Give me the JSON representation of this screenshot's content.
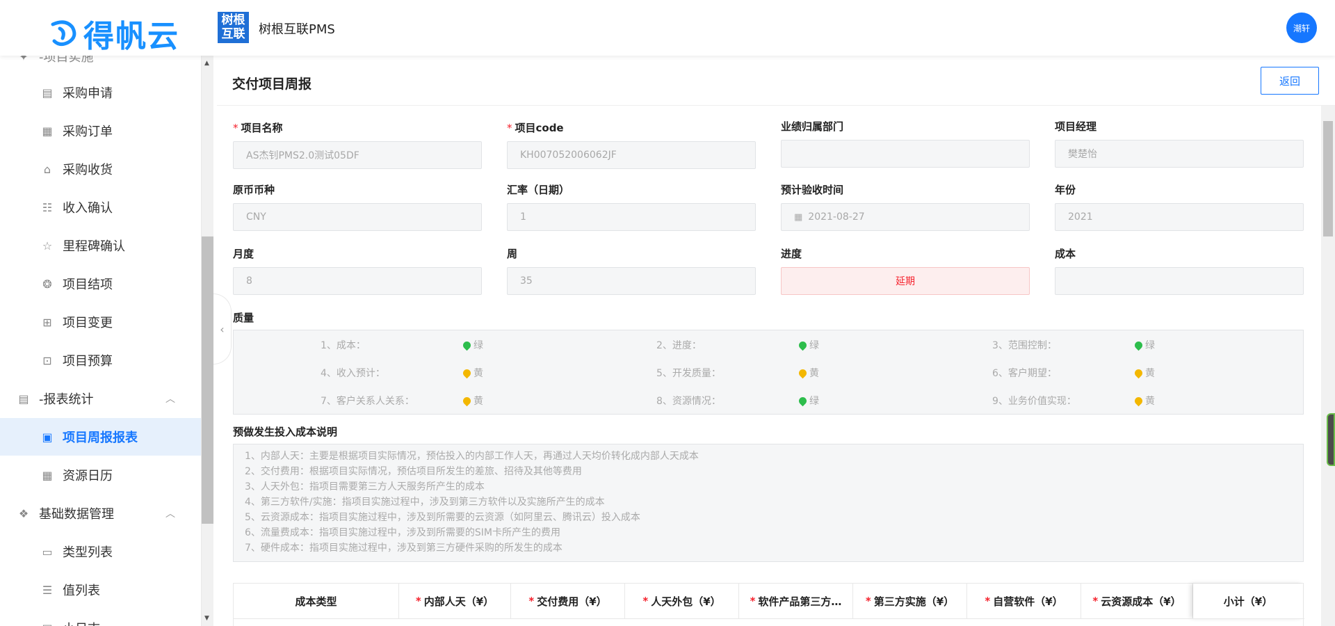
{
  "header": {
    "logo_text": "得帆云",
    "brand_box_text": "树根互联",
    "app_title": "树根互联PMS",
    "avatar_text": "潮轩"
  },
  "sidebar": {
    "partial_top": "-项目实施",
    "items": [
      {
        "label": "采购申请",
        "icon": "form-icon"
      },
      {
        "label": "采购订单",
        "icon": "order-icon"
      },
      {
        "label": "采购收货",
        "icon": "home-icon"
      },
      {
        "label": "收入确认",
        "icon": "list-icon"
      },
      {
        "label": "里程碑确认",
        "icon": "star-icon"
      },
      {
        "label": "项目结项",
        "icon": "award-icon"
      },
      {
        "label": "项目变更",
        "icon": "grid-icon"
      },
      {
        "label": "项目预算",
        "icon": "ticket-icon"
      }
    ],
    "group_report": "-报表统计",
    "active_item": "项目周报报表",
    "item_calendar": "资源日历",
    "group_base": "基础数据管理",
    "item_type_list": "类型列表",
    "item_value_list": "值列表",
    "partial_bottom": "小日志"
  },
  "page": {
    "title": "交付项目周报",
    "back_label": "返回"
  },
  "fields": {
    "project_name": {
      "label": "项目名称",
      "value": "AS杰钊PMS2.0测试05DF"
    },
    "project_code": {
      "label": "项目code",
      "value": "KH007052006062JF"
    },
    "dept": {
      "label": "业绩归属部门",
      "value": ""
    },
    "manager": {
      "label": "项目经理",
      "value": "樊楚怡"
    },
    "currency": {
      "label": "原币币种",
      "value": "CNY"
    },
    "rate": {
      "label": "汇率（日期）",
      "value": "1"
    },
    "accept_date": {
      "label": "预计验收时间",
      "value": "2021-08-27"
    },
    "year": {
      "label": "年份",
      "value": "2021"
    },
    "month": {
      "label": "月度",
      "value": "8"
    },
    "week": {
      "label": "周",
      "value": "35"
    },
    "progress": {
      "label": "进度",
      "value": "延期"
    },
    "cost": {
      "label": "成本",
      "value": ""
    }
  },
  "quality": {
    "label": "质量",
    "items": [
      {
        "name": "1、成本：",
        "value": "绿",
        "color": "#2dbd4c"
      },
      {
        "name": "2、进度：",
        "value": "绿",
        "color": "#2dbd4c"
      },
      {
        "name": "3、范围控制：",
        "value": "绿",
        "color": "#2dbd4c"
      },
      {
        "name": "4、收入预计：",
        "value": "黄",
        "color": "#f3b700"
      },
      {
        "name": "5、开发质量：",
        "value": "黄",
        "color": "#f3b700"
      },
      {
        "name": "6、客户期望：",
        "value": "黄",
        "color": "#f3b700"
      },
      {
        "name": "7、客户关系人关系：",
        "value": "黄",
        "color": "#f3b700"
      },
      {
        "name": "8、资源情况：",
        "value": "绿",
        "color": "#2dbd4c"
      },
      {
        "name": "9、业务价值实现：",
        "value": "黄",
        "color": "#f3b700"
      }
    ]
  },
  "cost_desc": {
    "label": "预做发生投入成本说明",
    "lines": [
      "1、内部人天：主要是根据项目实际情况，预估投入的内部工作人天，再通过人天均价转化成内部人天成本",
      "2、交付费用：根据项目实际情况，预估项目所发生的差旅、招待及其他等费用",
      "3、人天外包：指项目需要第三方人天服务所产生的成本",
      "4、第三方软件/实施：指项目实施过程中，涉及到第三方软件以及实施所产生的成本",
      "5、云资源成本：指项目实施过程中，涉及到所需要的云资源（如阿里云、腾讯云）投入成本",
      "6、流量费成本：指项目实施过程中，涉及到所需要的SIM卡所产生的费用",
      "7、硬件成本：指项目实施过程中，涉及到第三方硬件采购的所发生的成本"
    ]
  },
  "table": {
    "columns": [
      {
        "label": "成本类型",
        "required": false
      },
      {
        "label": "内部人天（¥）",
        "required": true
      },
      {
        "label": "交付费用（¥）",
        "required": true
      },
      {
        "label": "人天外包（¥）",
        "required": true
      },
      {
        "label": "软件产品第三方…",
        "required": true
      },
      {
        "label": "第三方实施（¥）",
        "required": true
      },
      {
        "label": "自营软件（¥）",
        "required": true
      },
      {
        "label": "云资源成本（¥）",
        "required": true
      },
      {
        "label": "小计（¥）",
        "required": false
      }
    ]
  }
}
